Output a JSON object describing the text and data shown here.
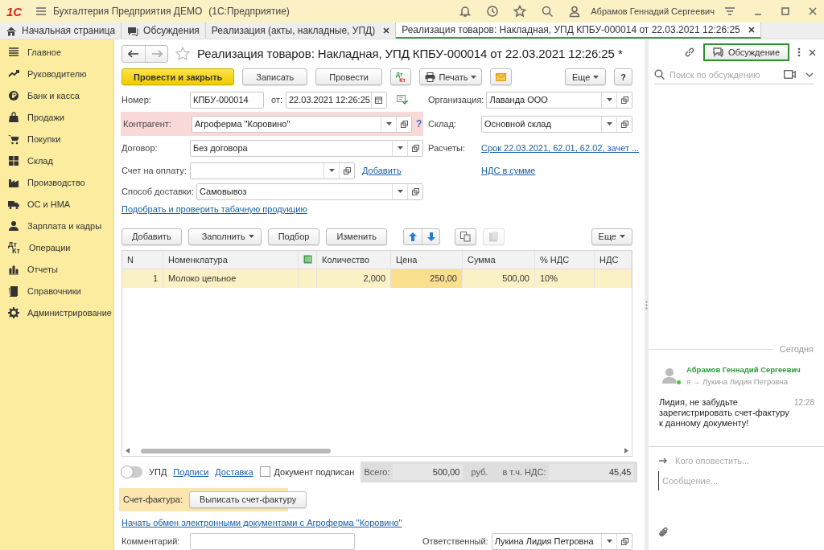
{
  "app": {
    "logo": "1С",
    "title": "Бухгалтерия Предприятия ДЕМО",
    "platform": "(1С:Предприятие)",
    "user": "Абрамов Геннадий Сергеевич"
  },
  "tabs": [
    {
      "label": "Начальная страница",
      "closable": false,
      "selected": false
    },
    {
      "label": "Обсуждения",
      "closable": false,
      "selected": false
    },
    {
      "label": "Реализация (акты, накладные, УПД)",
      "closable": true,
      "selected": false
    },
    {
      "label": "Реализация товаров: Накладная, УПД КПБУ-000014 от 22.03.2021 12:26:25",
      "closable": true,
      "selected": true
    }
  ],
  "sidebar": {
    "items": [
      {
        "label": "Главное"
      },
      {
        "label": "Руководителю"
      },
      {
        "label": "Банк и касса"
      },
      {
        "label": "Продажи"
      },
      {
        "label": "Покупки"
      },
      {
        "label": "Склад"
      },
      {
        "label": "Производство"
      },
      {
        "label": "ОС и НМА"
      },
      {
        "label": "Зарплата и кадры"
      },
      {
        "label": "Операции",
        "icon_text": {
          "top": "Дт",
          "bottom": "Кт"
        }
      },
      {
        "label": "Отчеты"
      },
      {
        "label": "Справочники"
      },
      {
        "label": "Администрирование"
      }
    ]
  },
  "document": {
    "title": "Реализация товаров: Накладная, УПД КПБУ-000014 от 22.03.2021 12:26:25 *",
    "favorite": false,
    "toolbar": [
      {
        "kind": "primary",
        "label": "Провести и закрыть"
      },
      {
        "kind": "button",
        "label": "Записать"
      },
      {
        "kind": "button",
        "label": "Провести"
      },
      {
        "kind": "dtkt",
        "top": "Дт",
        "bottom": "Кт"
      },
      {
        "kind": "print",
        "label": "Печать"
      },
      {
        "kind": "mail"
      }
    ],
    "toolbar_right": [
      {
        "kind": "menu",
        "label": "Еще"
      },
      {
        "kind": "button",
        "label": "?"
      }
    ],
    "number": {
      "label": "Номер:",
      "value": "КПБУ-000014"
    },
    "date": {
      "label": "от:",
      "value": "22.03.2021 12:26:25"
    },
    "left_fields": [
      {
        "label": "Контрагент:",
        "value": "Агроферма \"Коровино\"",
        "invalid": true,
        "help": "?"
      },
      {
        "label": "Договор:",
        "value": "Без договора",
        "invalid": false
      },
      {
        "label": "Счет на оплату:",
        "invalid": false,
        "link": "Добавить"
      },
      {
        "label": "Способ доставки:",
        "value": "Самовывоз",
        "invalid": false
      }
    ],
    "right_fields": [
      {
        "kind": "select",
        "label": "Организация:",
        "value": "Лаванда ООО"
      },
      {
        "kind": "select",
        "label": "Склад:",
        "value": "Основной склад"
      },
      {
        "kind": "link",
        "label": "Расчеты:",
        "link": "Срок 22.03.2021, 62.01, 62.02, зачет ..."
      },
      {
        "kind": "link",
        "link": "НДС в сумме"
      }
    ],
    "tobacco_link": "Подобрать и проверить табачную продукцию",
    "table_toolbar": [
      {
        "kind": "button",
        "label": "Добавить"
      },
      {
        "kind": "menu",
        "label": "Заполнить"
      },
      {
        "kind": "button",
        "label": "Подбор"
      },
      {
        "kind": "button",
        "label": "Изменить"
      },
      {
        "kind": "up"
      },
      {
        "kind": "down"
      },
      {
        "kind": "copy",
        "disabled": false
      },
      {
        "kind": "paste",
        "disabled": true
      }
    ],
    "table_toolbar_right": {
      "label": "Еще"
    },
    "table": {
      "columns": [
        {
          "kind": "text",
          "label": "N"
        },
        {
          "kind": "text",
          "label": "Номенклатура"
        },
        {
          "kind": "icon"
        },
        {
          "kind": "text",
          "label": "Количество"
        },
        {
          "kind": "text",
          "label": "Цена"
        },
        {
          "kind": "text",
          "label": "Сумма"
        },
        {
          "kind": "text",
          "label": "% НДС"
        },
        {
          "kind": "text",
          "label": "НДС"
        }
      ],
      "rows": [
        {
          "selected": true,
          "cells": [
            {
              "text": "1",
              "active": false
            },
            {
              "text": "Молоко цельное",
              "active": false
            },
            {
              "active": false
            },
            {
              "text": "2,000",
              "active": false
            },
            {
              "text": "250,00",
              "active": true
            },
            {
              "text": "500,00",
              "active": false
            },
            {
              "text": "10%",
              "active": false
            },
            {
              "active": false
            }
          ]
        }
      ]
    },
    "upd": {
      "label": "УПД",
      "on": false
    },
    "footer_links": [
      "Подписи",
      "Доставка"
    ],
    "signed": {
      "label": "Документ подписан",
      "checked": false
    },
    "totals": {
      "label": "Всего:",
      "value": "500,00",
      "currency": "руб.",
      "vat_label": "в т.ч. НДС:",
      "vat_value": "45,45"
    },
    "invoice": {
      "label": "Счет-фактура:",
      "button": "Выписать счет-фактуру"
    },
    "edo_link": "Начать обмен электронными документами с Агроферма \"Коровино\"",
    "comment": {
      "label": "Комментарий:"
    },
    "responsible": {
      "label": "Ответственный:",
      "value": "Лукина Лидия Петровна"
    }
  },
  "discussion": {
    "button": "Обсуждение",
    "search_placeholder": "Поиск по обсуждению",
    "date_divider": "Сегодня",
    "messages": [
      {
        "author": "Абрамов Геннадий Сергеевич",
        "online": true,
        "route": "я → Лукина Лидия Петровна",
        "time": "12:28",
        "text": "Лидия, не забудьте зарегистрировать счет-фактуру к данному документу!"
      }
    ],
    "notify_placeholder": "Кого оповестить...",
    "message_placeholder": "Сообщение..."
  }
}
